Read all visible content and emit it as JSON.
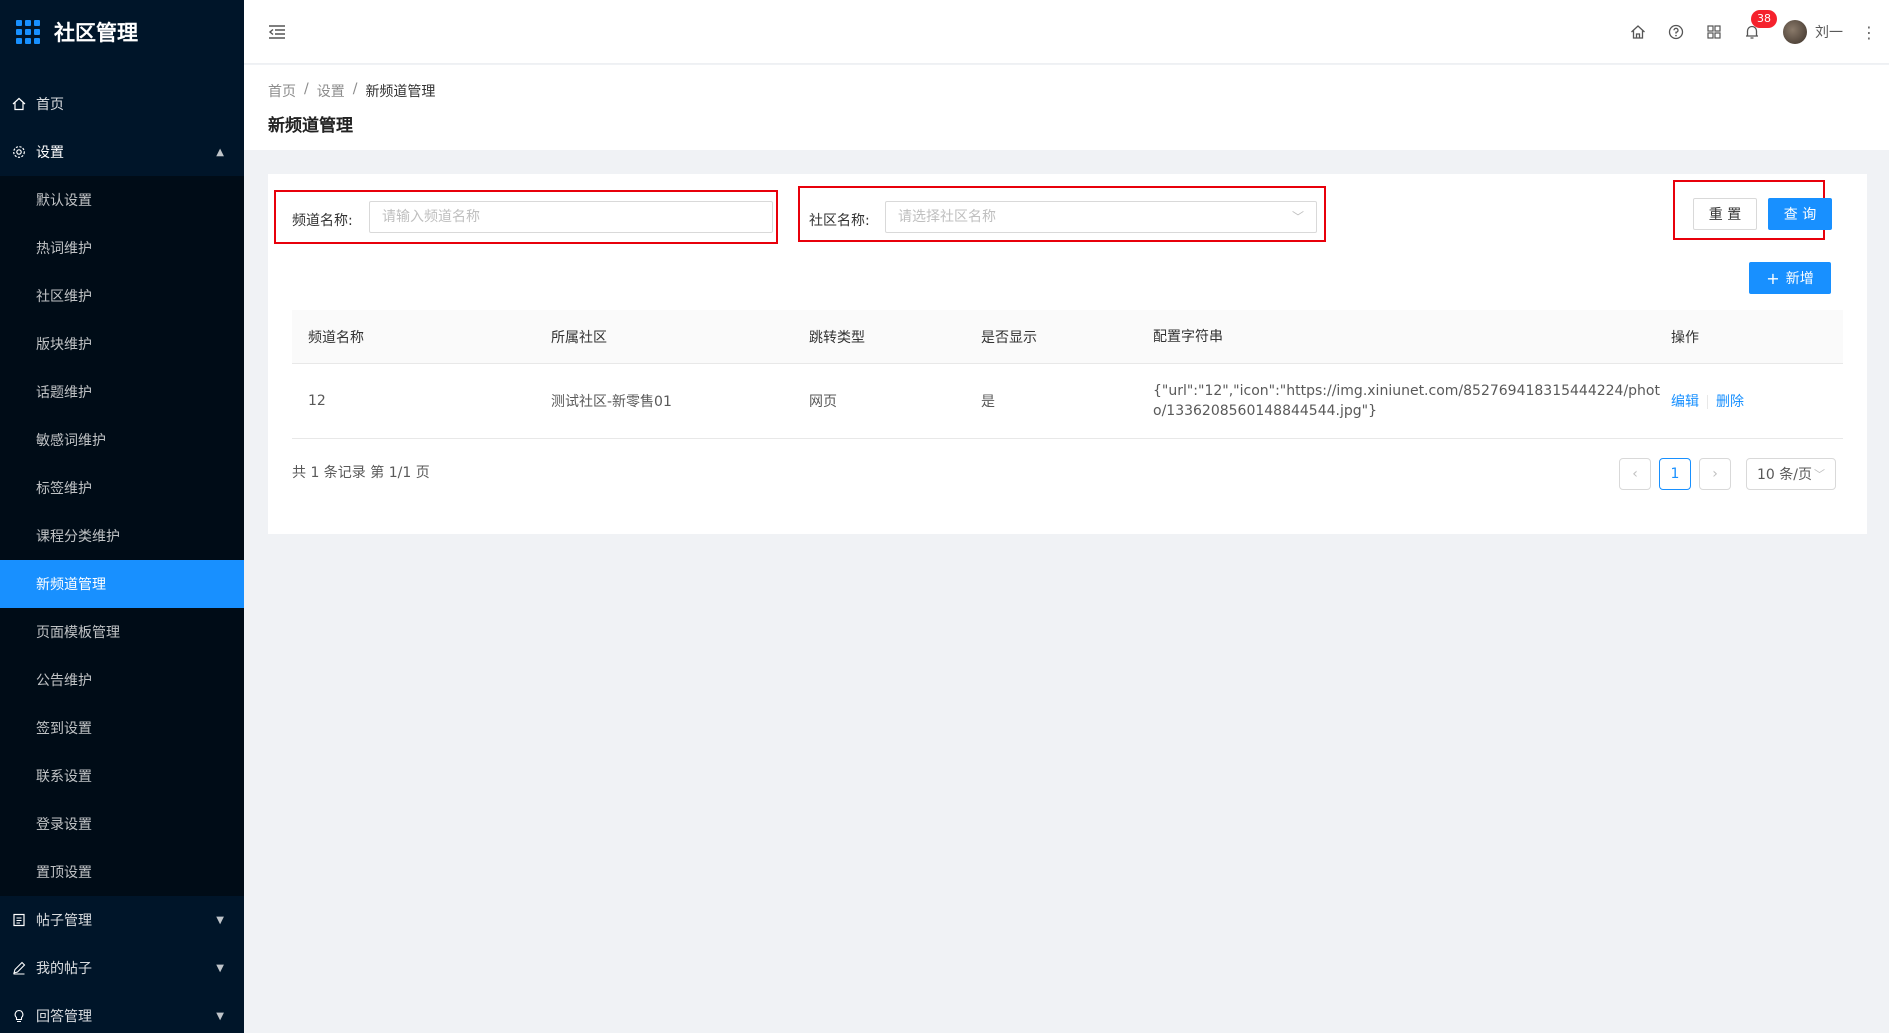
{
  "app": {
    "title": "社区管理"
  },
  "sidebar": {
    "items": [
      {
        "label": "首页",
        "icon": "home-icon"
      },
      {
        "label": "设置",
        "icon": "gear-icon",
        "expanded": true
      }
    ],
    "settings_sub": [
      "默认设置",
      "热词维护",
      "社区维护",
      "版块维护",
      "话题维护",
      "敏感词维护",
      "标签维护",
      "课程分类维护",
      "新频道管理",
      "页面模板管理",
      "公告维护",
      "签到设置",
      "联系设置",
      "登录设置",
      "置顶设置"
    ],
    "active_sub": "新频道管理",
    "bottom": [
      {
        "label": "帖子管理",
        "icon": "document-icon"
      },
      {
        "label": "我的帖子",
        "icon": "pen-icon"
      },
      {
        "label": "回答管理",
        "icon": "bulb-icon"
      }
    ]
  },
  "header": {
    "notification_count": "38",
    "user_name": "刘一"
  },
  "breadcrumb": {
    "home": "首页",
    "settings": "设置",
    "current": "新频道管理"
  },
  "page_title": "新频道管理",
  "filters": {
    "channel_label": "频道名称:",
    "channel_placeholder": "请输入频道名称",
    "community_label": "社区名称:",
    "community_placeholder": "请选择社区名称",
    "reset_label": "重 置",
    "search_label": "查 询",
    "add_label": "新增"
  },
  "table": {
    "columns": [
      "频道名称",
      "所属社区",
      "跳转类型",
      "是否显示",
      "配置字符串",
      "操作"
    ],
    "rows": [
      {
        "name": "12",
        "community": "测试社区-新零售01",
        "jump_type": "网页",
        "visible": "是",
        "config": "{\"url\":\"12\",\"icon\":\"https://img.xiniunet.com/852769418315444224/photo/1336208560148844544.jpg\"}",
        "edit": "编辑",
        "delete": "删除"
      }
    ]
  },
  "pagination": {
    "summary": "共 1 条记录 第 1/1 页",
    "current_page": "1",
    "page_size": "10 条/页"
  },
  "colors": {
    "primary": "#1890ff",
    "sidebar": "#001529",
    "highlight": "#e8000b",
    "badge": "#f5222d"
  }
}
